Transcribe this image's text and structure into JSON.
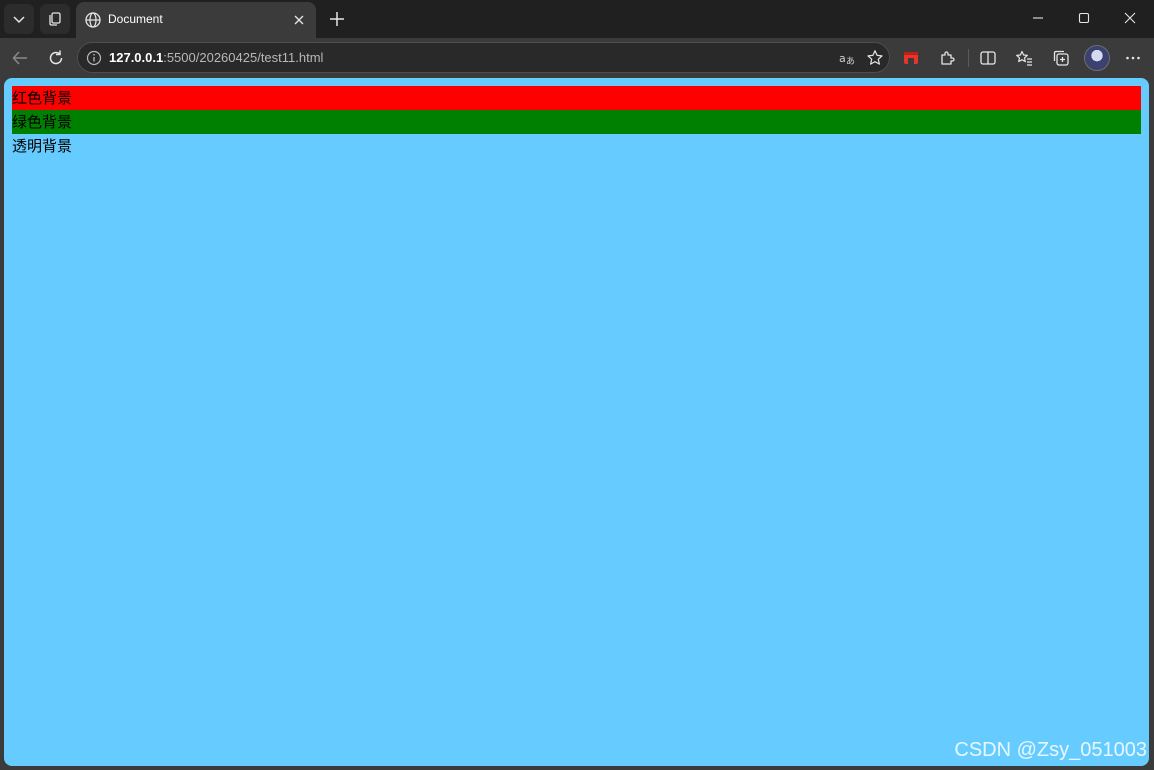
{
  "window": {
    "tab_title": "Document",
    "url_host": "127.0.0.1",
    "url_rest": ":5500/20260425/test11.html"
  },
  "page": {
    "background": "#66ccff",
    "blocks": [
      {
        "text": "红色背景",
        "background": "#ff0000"
      },
      {
        "text": "绿色背景",
        "background": "#008000"
      },
      {
        "text": "透明背景",
        "background": "transparent"
      }
    ]
  },
  "watermark": "CSDN @Zsy_051003",
  "icons": {
    "tab_actions": "chevron-down-icon",
    "workspaces": "workspaces-icon",
    "tab_favicon": "globe-icon",
    "close_tab": "close-icon",
    "new_tab": "plus-icon",
    "minimize": "minimize-icon",
    "maximize": "maximize-icon",
    "close_window": "close-icon",
    "back": "back-arrow-icon",
    "refresh": "refresh-icon",
    "site_info": "info-icon",
    "read_aloud": "translate-icon",
    "favorite": "star-icon",
    "extension_red": "extension-icon",
    "extensions": "puzzle-icon",
    "split_screen": "split-screen-icon",
    "favorites": "favorites-icon",
    "collections": "collections-icon",
    "profile": "avatar",
    "menu": "more-icon"
  }
}
